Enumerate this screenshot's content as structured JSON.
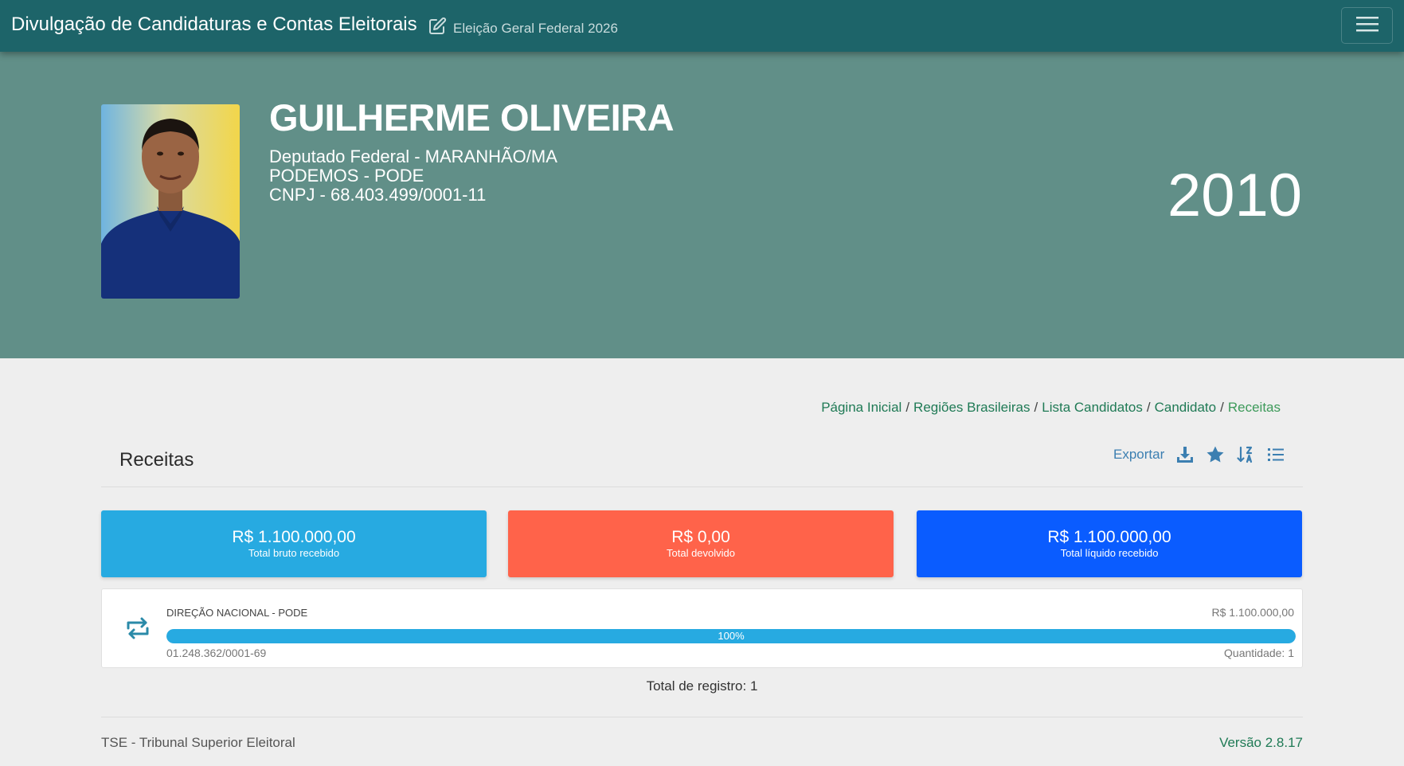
{
  "header": {
    "title": "Divulgação de Candidaturas e Contas Eleitorais",
    "election": "Eleição Geral Federal 2026"
  },
  "candidate": {
    "name": "GUILHERME OLIVEIRA",
    "office": "Deputado Federal - MARANHÃO/MA",
    "party": "PODEMOS - PODE",
    "cnpj": "CNPJ - 68.403.499/0001-11",
    "year": "2010"
  },
  "breadcrumb": {
    "items": [
      "Página Inicial",
      "Regiões Brasileiras",
      "Lista Candidatos",
      "Candidato"
    ],
    "current": "Receitas"
  },
  "section": {
    "title": "Receitas",
    "export_label": "Exportar",
    "icons": [
      "download-icon",
      "star-icon",
      "sort-icon",
      "list-icon"
    ]
  },
  "summary": [
    {
      "value": "R$ 1.100.000,00",
      "label": "Total bruto recebido",
      "color": "#27aae1"
    },
    {
      "value": "R$ 0,00",
      "label": "Total devolvido",
      "color": "#ff634a"
    },
    {
      "value": "R$ 1.100.000,00",
      "label": "Total líquido recebido",
      "color": "#0a5cff"
    }
  ],
  "records": [
    {
      "name": "DIREÇÃO NACIONAL - PODE",
      "value": "R$ 1.100.000,00",
      "percent_label": "100%",
      "percent": 100,
      "cnpj": "01.248.362/0001-69",
      "quantity": "Quantidade: 1"
    }
  ],
  "total_records": "Total de registro: 1",
  "footer": {
    "org": "TSE - Tribunal Superior Eleitoral",
    "version": "Versão 2.8.17"
  },
  "colors": {
    "navbar": "#1d6469",
    "hero": "#618f88",
    "link": "#1f7a55",
    "export": "#3c7fb1"
  }
}
